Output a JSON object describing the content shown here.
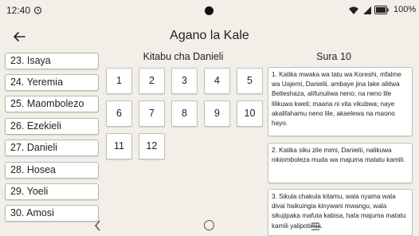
{
  "status": {
    "time": "12:40",
    "battery": "100%"
  },
  "header": {
    "title": "Agano la Kale"
  },
  "books": [
    "23. Isaya",
    "24. Yeremia",
    "25. Maombolezo",
    "26. Ezekieli",
    "27. Danieli",
    "28. Hosea",
    "29. Yoeli",
    "30. Amosi"
  ],
  "chapters": {
    "heading": "Kitabu cha Danieli",
    "numbers": [
      "1",
      "2",
      "3",
      "4",
      "5",
      "6",
      "7",
      "8",
      "9",
      "10",
      "11",
      "12"
    ]
  },
  "verses": {
    "heading": "Sura 10",
    "items": [
      "1. Katika mwaka wa tatu wa Koreshi, mfalme wa Uajemi, Danielii, ambaye jina lake aliitwa Belteshaza, alifunuliwa neno; na neno lile lilikuwa kweli; maana ni vita vikubwa; naye akalifahamu neno lile, akaelewa na maono hayo.",
      "2. Katika siku zile mimi, Danielii, nalikuwa nikiomboleza muda wa majuma matatu kamili.",
      "3. Sikula chakula kitamu, wala nyama wala divai haikuingia kinywani mwangu, wala sikujipaka mafuta kabisa, hata majuma matatu kamili yalipotimia."
    ]
  }
}
